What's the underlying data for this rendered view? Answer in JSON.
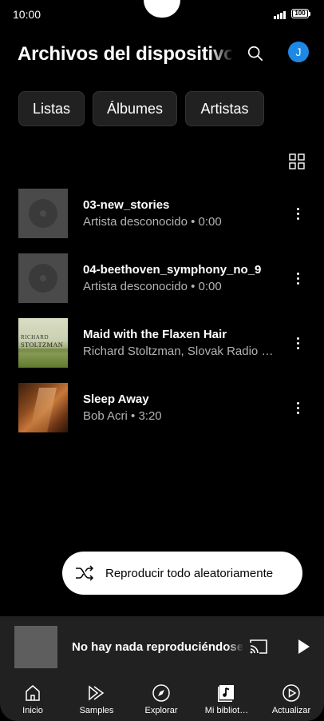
{
  "status": {
    "time": "10:00",
    "battery": "100"
  },
  "header": {
    "title": "Archivos del dispositivo",
    "avatar_letter": "J",
    "accent": "#1e88e5"
  },
  "chips": [
    {
      "label": "Listas"
    },
    {
      "label": "Álbumes"
    },
    {
      "label": "Artistas"
    }
  ],
  "tracks": [
    {
      "title": "03-new_stories",
      "subtitle": "Artista desconocido • 0:00",
      "art": "placeholder-disc"
    },
    {
      "title": "04-beethoven_symphony_no_9",
      "subtitle": "Artista desconocido • 0:00",
      "art": "placeholder-disc"
    },
    {
      "title": "Maid with the Flaxen Hair",
      "subtitle": "Richard Stoltzman, Slovak Radio Symphony Orchestra",
      "art": "album-cover",
      "art_text": [
        "RICHARD",
        "STOLTZMAN"
      ]
    },
    {
      "title": "Sleep Away",
      "subtitle": "Bob Acri • 3:20",
      "art": "album-cover"
    }
  ],
  "shuffle": {
    "label": "Reproducir todo aleatoriamente"
  },
  "player": {
    "text": "No hay nada reproduciéndose"
  },
  "nav": [
    {
      "label": "Inicio",
      "icon": "home-icon"
    },
    {
      "label": "Samples",
      "icon": "samples-icon"
    },
    {
      "label": "Explorar",
      "icon": "compass-icon"
    },
    {
      "label": "Mi bibliot…",
      "icon": "library-icon"
    },
    {
      "label": "Actualizar",
      "icon": "upgrade-icon"
    }
  ]
}
